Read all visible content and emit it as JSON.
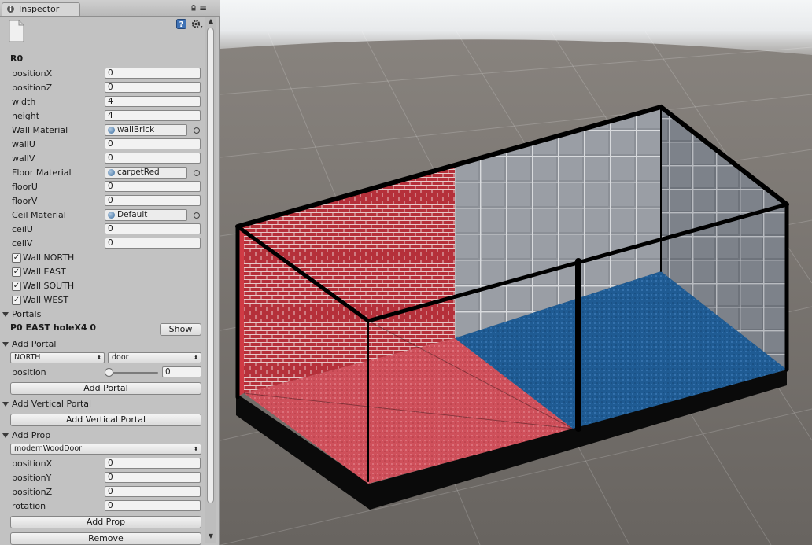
{
  "inspector": {
    "tab_label": "Inspector",
    "object_name": "R0",
    "fields_a": [
      {
        "label": "positionX",
        "value": "0"
      },
      {
        "label": "positionZ",
        "value": "0"
      },
      {
        "label": "width",
        "value": "4"
      },
      {
        "label": "height",
        "value": "4"
      }
    ],
    "wall_material": {
      "label": "Wall Material",
      "value": "wallBrick"
    },
    "wall_uv": [
      {
        "label": "wallU",
        "value": "0"
      },
      {
        "label": "wallV",
        "value": "0"
      }
    ],
    "floor_material": {
      "label": "Floor Material",
      "value": "carpetRed"
    },
    "floor_uv": [
      {
        "label": "floorU",
        "value": "0"
      },
      {
        "label": "floorV",
        "value": "0"
      }
    ],
    "ceil_material": {
      "label": "Ceil Material",
      "value": "Default"
    },
    "ceil_uv": [
      {
        "label": "ceilU",
        "value": "0"
      },
      {
        "label": "ceilV",
        "value": "0"
      }
    ],
    "walls": [
      {
        "label": "Wall NORTH",
        "checked": true,
        "mark": "✓"
      },
      {
        "label": "Wall EAST",
        "checked": true,
        "mark": "✓"
      },
      {
        "label": "Wall SOUTH",
        "checked": true,
        "mark": "✓"
      },
      {
        "label": "Wall WEST",
        "checked": true,
        "mark": "✓"
      }
    ],
    "portals": {
      "header": "Portals",
      "entry": "P0 EAST holeX4 0",
      "show_button": "Show"
    },
    "add_portal": {
      "header": "Add Portal",
      "direction": "NORTH",
      "type": "door",
      "position_label": "position",
      "position_value": "0",
      "slider_fraction": 0,
      "button": "Add Portal"
    },
    "add_vertical_portal": {
      "header": "Add Vertical Portal",
      "button": "Add Vertical Portal"
    },
    "add_prop": {
      "header": "Add Prop",
      "prop": "modernWoodDoor",
      "fields": [
        {
          "label": "positionX",
          "value": "0"
        },
        {
          "label": "positionY",
          "value": "0"
        },
        {
          "label": "positionZ",
          "value": "0"
        },
        {
          "label": "rotation",
          "value": "0"
        }
      ],
      "button": "Add Prop"
    },
    "remove_button": "Remove"
  },
  "icons": {
    "tab": "info-icon",
    "lock": "lock-icon",
    "menu": "menu-icon",
    "help": "help-icon",
    "gear": "gear-icon",
    "file": "file-icon"
  },
  "colors": {
    "panel_bg": "#c2c2c2",
    "brick": "#b8323a",
    "tile": "#8d9198",
    "carpet_red": "#d05560",
    "carpet_blue": "#1e5a94",
    "scene_ground": "#706b66",
    "sky": "#f2f4f5"
  }
}
